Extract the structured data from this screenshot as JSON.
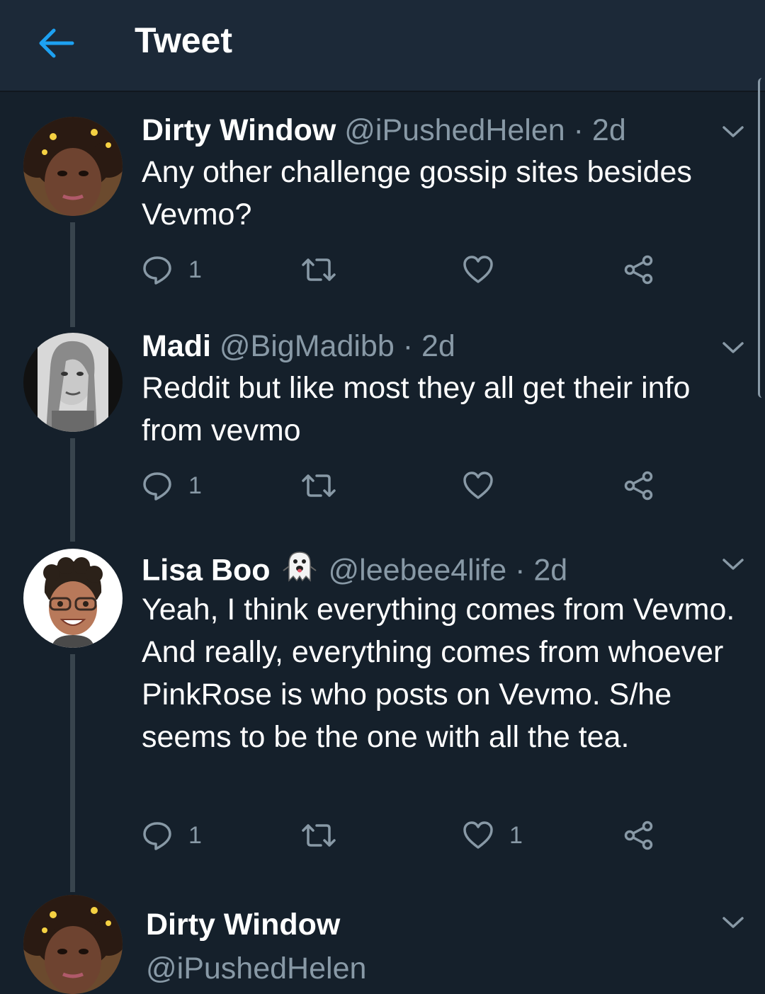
{
  "topbar": {
    "title": "Tweet"
  },
  "tweets": [
    {
      "name": "Dirty Window",
      "handle": "@iPushedHelen",
      "dot": "·",
      "time": "2d",
      "text": "Any other challenge gossip sites besides Vevmo?",
      "reply_count": "1",
      "retweet_count": "",
      "like_count": ""
    },
    {
      "name": "Madi",
      "handle": "@BigMadibb",
      "dot": "·",
      "time": "2d",
      "text": "Reddit but like most they all get their info from vevmo",
      "reply_count": "1",
      "retweet_count": "",
      "like_count": ""
    },
    {
      "name": "Lisa Boo",
      "handle": "@leebee4life",
      "dot": "·",
      "time": "2d",
      "text": "Yeah, I think everything comes from Vevmo. And really, everything comes from whoever PinkRose is who posts on Vevmo. S/he seems to be the one with all the tea.",
      "reply_count": "1",
      "retweet_count": "",
      "like_count": "1"
    }
  ],
  "focused": {
    "name": "Dirty Window",
    "handle": "@iPushedHelen"
  },
  "colors": {
    "background": "#15202b",
    "topbar": "#1c2938",
    "accent": "#1da1f2",
    "muted": "#8899a6"
  }
}
